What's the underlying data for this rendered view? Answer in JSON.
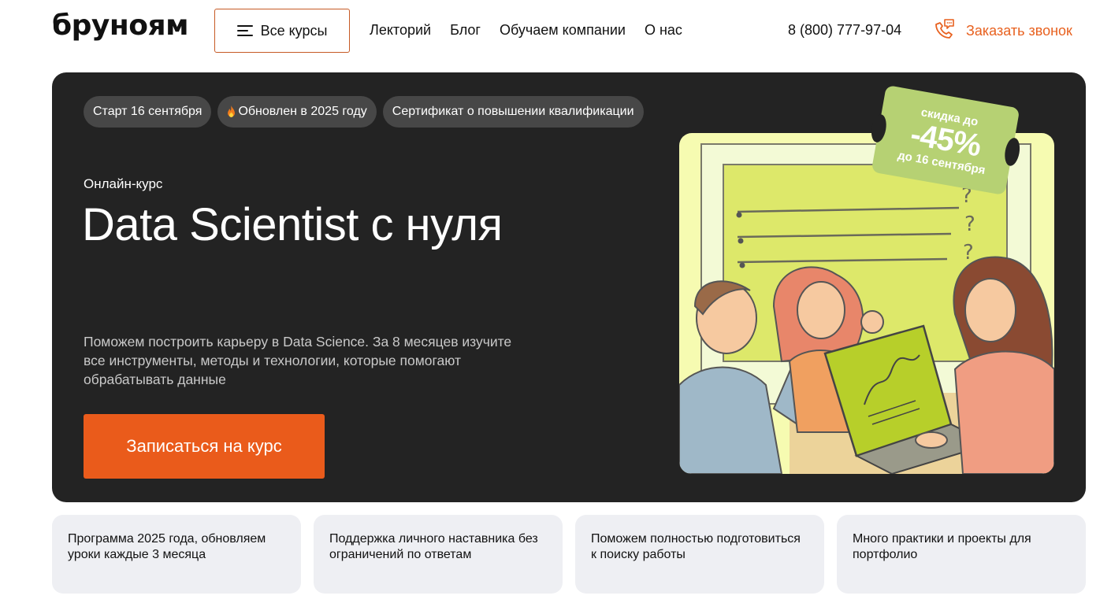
{
  "header": {
    "logo": "бруноям",
    "all_courses_label": "Все курсы",
    "nav": [
      "Лекторий",
      "Блог",
      "Обучаем компании",
      "О нас"
    ],
    "phone": "8 (800) 777-97-04",
    "callback_label": "Заказать звонок"
  },
  "hero": {
    "tags": [
      "Старт 16 сентября",
      "Обновлен в 2025 году",
      "Сертификат о повышении квалификации"
    ],
    "eyebrow": "Онлайн-курс",
    "title": "Data Scientist с нуля",
    "description": "Поможем построить карьеру в Data Science. За 8 месяцев изучите все инструменты, методы и технологии, которые помогают обрабатывать данные",
    "cta_label": "Записаться на курс",
    "discount": {
      "line1": "скидка до",
      "value": "-45%",
      "line3": "до 16 сентября"
    }
  },
  "features": [
    "Программа 2025 года, обновляем уроки каждые 3 месяца",
    "Поддержка личного наставника без ограничений по ответам",
    "Поможем полностью подготовиться к поиску работы",
    "Много практики и проекты для портфолио"
  ],
  "colors": {
    "accent": "#ea5b1b",
    "hero_bg": "#232323",
    "tag_bg": "#474747",
    "badge_green": "#b6d173",
    "feature_bg": "#eeeff3",
    "illustration_bg": "#f6fbb1"
  },
  "icons": {
    "menu": "burger-icon",
    "callback": "phone-chat-icon",
    "tag_updated": "fire-icon"
  }
}
